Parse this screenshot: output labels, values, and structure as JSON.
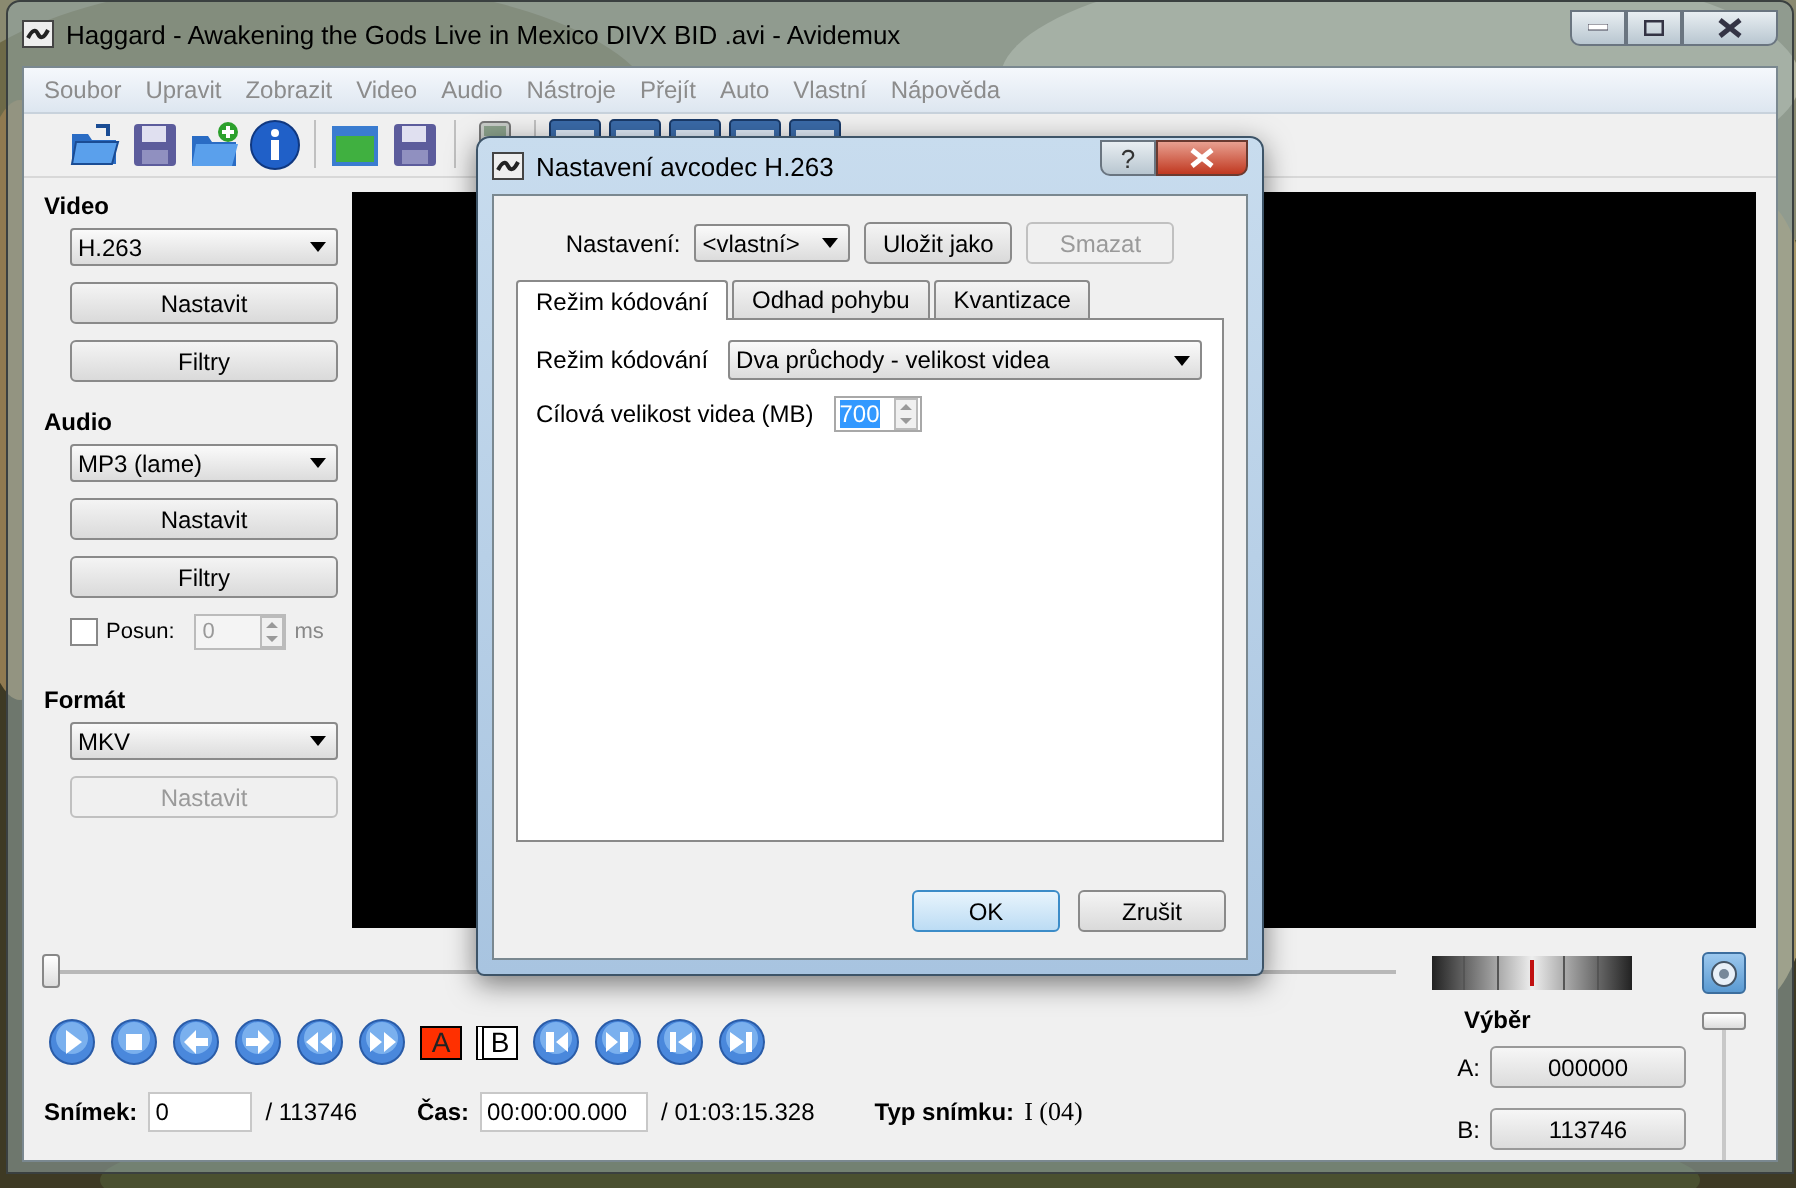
{
  "window": {
    "title": "Haggard - Awakening the Gods Live in Mexico DIVX BID .avi - Avidemux"
  },
  "menu": [
    "Soubor",
    "Upravit",
    "Zobrazit",
    "Video",
    "Audio",
    "Nástroje",
    "Přejít",
    "Auto",
    "Vlastní",
    "Nápověda"
  ],
  "video": {
    "heading": "Video",
    "codec": "H.263",
    "buttons": [
      "Nastavit",
      "Filtry"
    ]
  },
  "audio": {
    "heading": "Audio",
    "codec": "MP3 (lame)",
    "buttons": [
      "Nastavit",
      "Filtry"
    ],
    "shift": {
      "label": "Posun:",
      "checked": false,
      "value": "0",
      "unit": "ms",
      "disabled": true
    }
  },
  "format": {
    "heading": "Formát",
    "container": "MKV",
    "button": {
      "label": "Nastavit",
      "disabled": true
    }
  },
  "timeline": {
    "level": 0
  },
  "markers": [
    "A",
    "B"
  ],
  "status": {
    "frame_label": "Snímek:",
    "frame_value": "0",
    "frame_total": "/ 113746",
    "time_label": "Čas:",
    "time_value": "00:00:00.000",
    "time_total": "/ 01:03:15.328",
    "type_label": "Typ snímku:",
    "type_value": "I (04)"
  },
  "selection": {
    "heading": "Výběr",
    "rows": [
      {
        "label": "A:",
        "value": "000000"
      },
      {
        "label": "B:",
        "value": "113746"
      }
    ]
  },
  "volume": {
    "level": 1
  },
  "dialog": {
    "title": "Nastavení avcodec H.263",
    "help": "?",
    "preset_label": "Nastavení:",
    "preset": "<vlastní>",
    "buttons": [
      {
        "label": "Uložit jako",
        "disabled": false
      },
      {
        "label": "Smazat",
        "disabled": true
      }
    ],
    "tabs": [
      {
        "label": "Režim kódování",
        "selected": true
      },
      {
        "label": "Odhad pohybu",
        "selected": false
      },
      {
        "label": "Kvantizace",
        "selected": false
      }
    ],
    "fields": [
      {
        "kind": "select",
        "label": "Režim kódování",
        "value": "Dva průchody - velikost videa"
      },
      {
        "kind": "spin",
        "label": "Cílová velikost videa (MB)",
        "value": "700",
        "selected": true
      }
    ],
    "ok": "OK",
    "cancel": "Zrušit"
  }
}
